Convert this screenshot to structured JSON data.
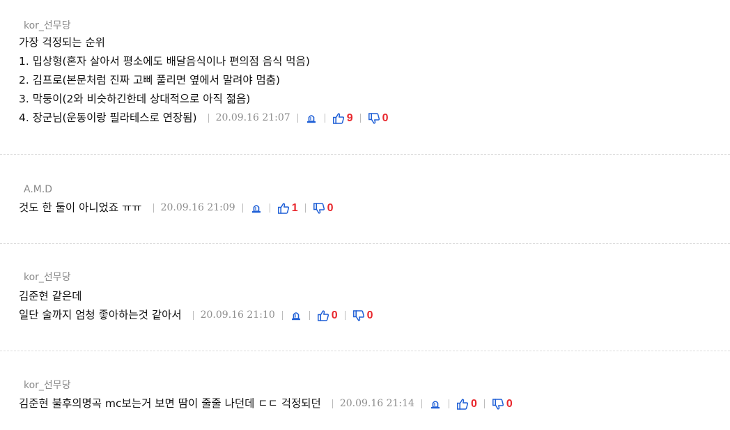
{
  "comments": [
    {
      "author": "kor_선무당",
      "lines": [
        "가장 걱정되는 순위",
        "1. 밉상형(혼자 살아서 평소에도 배달음식이나 편의점 음식 먹음)",
        "2. 김프로(본문처럼 진짜 고삐 풀리면 옆에서 말려야 멈춤)",
        "3. 막둥이(2와 비슷하긴한데 상대적으로 아직 젊음)",
        "4. 장군님(운동이랑 필라테스로 연장됨)"
      ],
      "date": "20.09.16 21:07",
      "likes": "9",
      "dislikes": "0"
    },
    {
      "author": "A.M.D",
      "lines": [
        "것도 한 둘이 아니었죠 ㅠㅠ"
      ],
      "date": "20.09.16 21:09",
      "likes": "1",
      "dislikes": "0"
    },
    {
      "author": "kor_선무당",
      "lines": [
        "김준현 같은데",
        "일단 술까지 엄청 좋아하는것 같아서"
      ],
      "date": "20.09.16 21:10",
      "likes": "0",
      "dislikes": "0"
    },
    {
      "author": "kor_선무당",
      "lines": [
        "김준현 불후의명곡 mc보는거 보면 땀이 줄줄 나던데 ㄷㄷ 걱정되던"
      ],
      "date": "20.09.16 21:14",
      "likes": "0",
      "dislikes": "0"
    }
  ],
  "icons": {
    "report": "siren-icon",
    "like": "thumbs-up-icon",
    "dislike": "thumbs-down-icon"
  },
  "colors": {
    "count": "#e8262c",
    "icon_blue": "#1e5fd6",
    "author": "#8a8a8a",
    "date": "#8e8e8e"
  }
}
